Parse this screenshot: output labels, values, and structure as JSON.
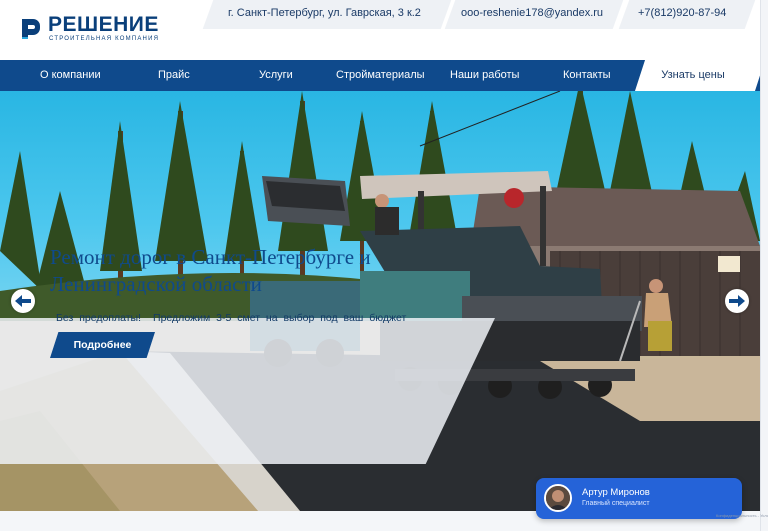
{
  "brand": {
    "name": "РЕШЕНИЕ",
    "tagline": "строительная компания",
    "color": "#0a3f7a"
  },
  "header": {
    "address": "г. Санкт-Петербург, ул. Гаврская, 3 к.2",
    "email": "ooo-reshenie178@yandex.ru",
    "phone": "+7(812)920-87-94"
  },
  "nav": {
    "items": [
      {
        "label": "О компании"
      },
      {
        "label": "Прайс"
      },
      {
        "label": "Услуги"
      },
      {
        "label": "Стройматериалы"
      },
      {
        "label": "Наши работы"
      },
      {
        "label": "Контакты"
      }
    ],
    "cta_label": "Узнать цены",
    "background": "#0f4a8c"
  },
  "hero": {
    "title": "Ремонт дорог в Санкт-Петербурге и Ленинградской области",
    "subtitle_left": "Без предоплаты!",
    "subtitle_right": "Предложим 3-5 смет на выбор под ваш бюджет",
    "button_label": "Подробнее",
    "prev_icon": "arrow-left-icon",
    "next_icon": "arrow-right-icon"
  },
  "chat": {
    "name": "Артур Миронов",
    "role": "Главный специалист",
    "color": "#2563d8"
  },
  "recaptcha": {
    "text": "Конфиденциальность - Условия использования"
  }
}
